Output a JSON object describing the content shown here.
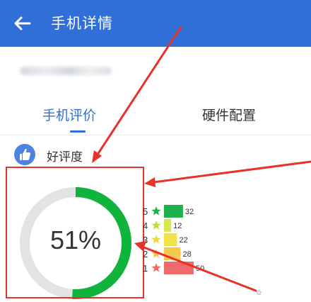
{
  "appbar": {
    "title": "手机详情",
    "back_icon": "arrow-left-icon"
  },
  "tabs": [
    {
      "label": "手机评价",
      "active": true
    },
    {
      "label": "硬件配置",
      "active": false
    }
  ],
  "section": {
    "label": "好评度",
    "icon": "thumbs-up-icon"
  },
  "rating": {
    "percent_label": "51%",
    "percent_value": 51,
    "colors": {
      "ring": "#10b43c",
      "track": "#e3e3e3",
      "accent": "#2f6fd7",
      "annotation": "#e8312a"
    }
  },
  "chart_data": {
    "type": "bar",
    "orientation": "horizontal",
    "categories": [
      "5",
      "4",
      "3",
      "2",
      "1"
    ],
    "values": [
      32,
      12,
      22,
      28,
      50
    ],
    "value_labels": [
      "32",
      "12",
      "22",
      "28",
      "50"
    ],
    "colors": [
      "#1fb14a",
      "#d7e84a",
      "#f3e34a",
      "#f7c84e",
      "#ef6b6b"
    ],
    "star_colors": [
      "#1fb14a",
      "#c7d93a",
      "#f0d63a",
      "#f3c246",
      "#ef6b6b"
    ],
    "title": "",
    "xlabel": "",
    "ylabel": "",
    "xlim": [
      0,
      50
    ]
  }
}
